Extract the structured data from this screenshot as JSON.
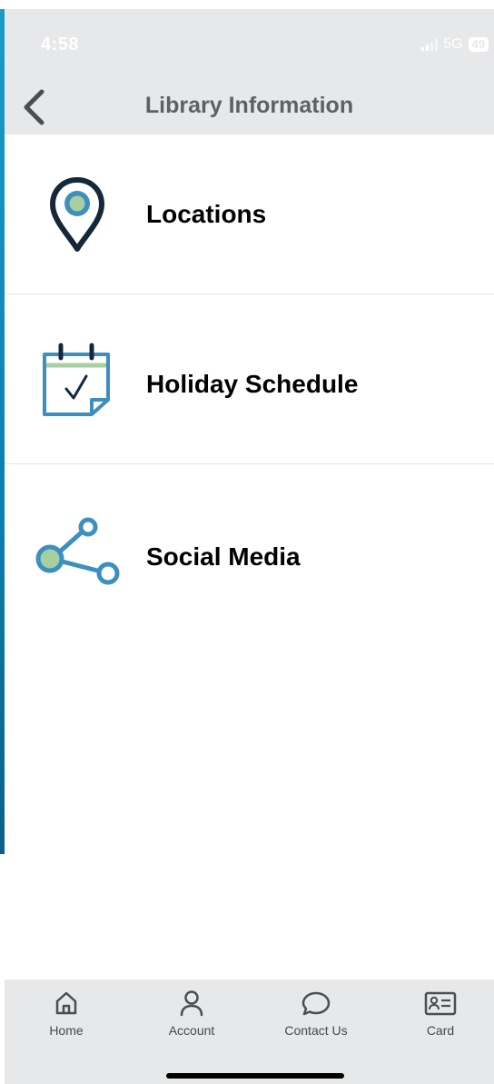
{
  "status_bar": {
    "time": "4:58",
    "network": "5G",
    "battery": "49"
  },
  "nav": {
    "title": "Library Information"
  },
  "menu": {
    "items": [
      {
        "label": "Locations",
        "icon": "location-pin-icon"
      },
      {
        "label": "Holiday Schedule",
        "icon": "calendar-check-icon"
      },
      {
        "label": "Social Media",
        "icon": "share-icon"
      }
    ]
  },
  "tabs": [
    {
      "label": "Home",
      "icon": "home-icon"
    },
    {
      "label": "Account",
      "icon": "person-icon"
    },
    {
      "label": "Contact Us",
      "icon": "chat-bubble-icon"
    },
    {
      "label": "Card",
      "icon": "id-card-icon"
    }
  ],
  "colors": {
    "icon_dark": "#14283a",
    "icon_blue": "#3d8fbf",
    "icon_green": "#a8cfa0",
    "bar_bg": "#e7e8ea",
    "accent_strip": "#0b7fae"
  }
}
